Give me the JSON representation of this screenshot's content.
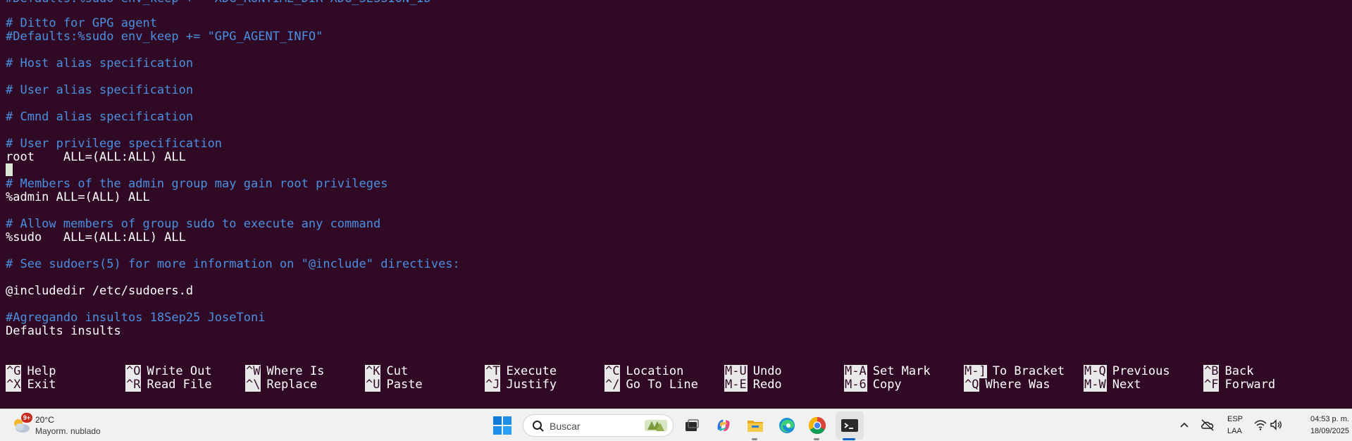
{
  "editor": {
    "partial_top_line": "#Defaults:%sudo env_keep += \"XDG_RUNTIME_DIR XDG_SESSION_ID\"",
    "lines": [
      {
        "text": "# Ditto for GPG agent",
        "type": "comment"
      },
      {
        "text": "#Defaults:%sudo env_keep += \"GPG_AGENT_INFO\"",
        "type": "comment"
      },
      {
        "text": "",
        "type": "plain"
      },
      {
        "text": "# Host alias specification",
        "type": "comment"
      },
      {
        "text": "",
        "type": "plain"
      },
      {
        "text": "# User alias specification",
        "type": "comment"
      },
      {
        "text": "",
        "type": "plain"
      },
      {
        "text": "# Cmnd alias specification",
        "type": "comment"
      },
      {
        "text": "",
        "type": "plain"
      },
      {
        "text": "# User privilege specification",
        "type": "comment"
      },
      {
        "text": "root    ALL=(ALL:ALL) ALL",
        "type": "plain"
      },
      {
        "text": "",
        "type": "plain"
      },
      {
        "text": "# Members of the admin group may gain root privileges",
        "type": "comment"
      },
      {
        "text": "%admin ALL=(ALL) ALL",
        "type": "plain"
      },
      {
        "text": "",
        "type": "plain"
      },
      {
        "text": "# Allow members of group sudo to execute any command",
        "type": "comment"
      },
      {
        "text": "%sudo   ALL=(ALL:ALL) ALL",
        "type": "plain"
      },
      {
        "text": "",
        "type": "plain"
      },
      {
        "text": "# See sudoers(5) for more information on \"@include\" directives:",
        "type": "comment"
      },
      {
        "text": "",
        "type": "plain"
      },
      {
        "text": "@includedir /etc/sudoers.d",
        "type": "plain"
      },
      {
        "text": "",
        "type": "plain"
      },
      {
        "text": "#Agregando insultos 18Sep25 JoseToni",
        "type": "comment"
      },
      {
        "text": "Defaults insults",
        "type": "plain"
      }
    ]
  },
  "shortcuts": {
    "row1": [
      {
        "key": "^G",
        "label": "Help"
      },
      {
        "key": "^O",
        "label": "Write Out"
      },
      {
        "key": "^W",
        "label": "Where Is"
      },
      {
        "key": "^K",
        "label": "Cut"
      },
      {
        "key": "^T",
        "label": "Execute"
      },
      {
        "key": "^C",
        "label": "Location"
      },
      {
        "key": "M-U",
        "label": "Undo"
      },
      {
        "key": "M-A",
        "label": "Set Mark"
      },
      {
        "key": "M-]",
        "label": "To Bracket"
      },
      {
        "key": "M-Q",
        "label": "Previous"
      },
      {
        "key": "^B",
        "label": "Back"
      }
    ],
    "row2": [
      {
        "key": "^X",
        "label": "Exit"
      },
      {
        "key": "^R",
        "label": "Read File"
      },
      {
        "key": "^\\",
        "label": "Replace"
      },
      {
        "key": "^U",
        "label": "Paste"
      },
      {
        "key": "^J",
        "label": "Justify"
      },
      {
        "key": "^/",
        "label": "Go To Line"
      },
      {
        "key": "M-E",
        "label": "Redo"
      },
      {
        "key": "M-6",
        "label": "Copy"
      },
      {
        "key": "^Q",
        "label": "Where Was"
      },
      {
        "key": "M-W",
        "label": "Next"
      },
      {
        "key": "^F",
        "label": "Forward"
      }
    ]
  },
  "taskbar": {
    "weather": {
      "badge": "9+",
      "temp": "20°C",
      "desc": "Mayorm. nublado",
      "icon": "cloud-sun-icon"
    },
    "search": {
      "placeholder": "Buscar"
    },
    "apps": [
      {
        "name": "task-view-icon"
      },
      {
        "name": "copilot-icon"
      },
      {
        "name": "file-explorer-icon"
      },
      {
        "name": "edge-icon"
      },
      {
        "name": "chrome-icon"
      },
      {
        "name": "terminal-icon"
      }
    ],
    "tray": {
      "lang_top": "ESP",
      "lang_bottom": "LAA",
      "time": "04:53 p. m.",
      "date": "18/09/2025"
    }
  },
  "colors": {
    "background": "#300a24",
    "comment": "#4a90e2",
    "text": "#ffffff",
    "key_bg": "#e9e9e9"
  }
}
